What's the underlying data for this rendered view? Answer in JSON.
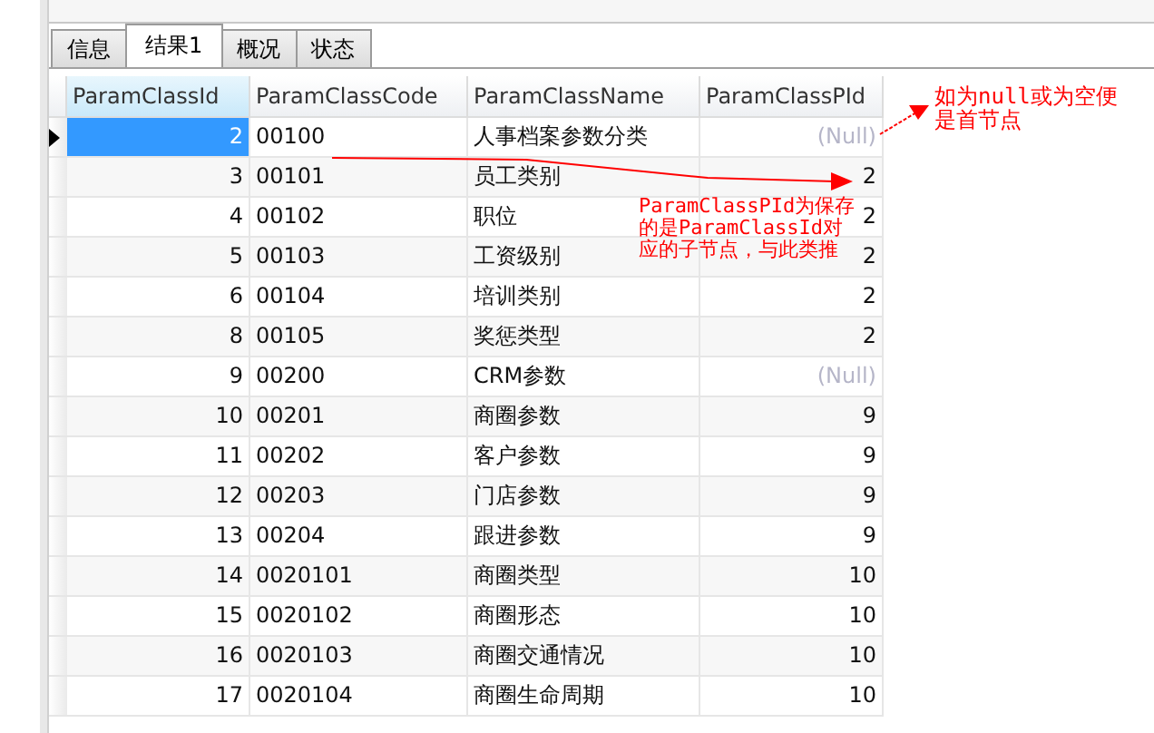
{
  "tabs": [
    {
      "label": "信息",
      "selected": false
    },
    {
      "label": "结果1",
      "selected": true
    },
    {
      "label": "概况",
      "selected": false
    },
    {
      "label": "状态",
      "selected": false
    }
  ],
  "table": {
    "columns": [
      "ParamClassId",
      "ParamClassCode",
      "ParamClassName",
      "ParamClassPId"
    ],
    "rows": [
      {
        "cells": [
          "2",
          "00100",
          "人事档案参数分类",
          "(Null)"
        ],
        "null_pid": true,
        "selected": true
      },
      {
        "cells": [
          "3",
          "00101",
          "员工类别",
          "2"
        ],
        "null_pid": false,
        "selected": false
      },
      {
        "cells": [
          "4",
          "00102",
          "职位",
          "2"
        ],
        "null_pid": false,
        "selected": false
      },
      {
        "cells": [
          "5",
          "00103",
          "工资级别",
          "2"
        ],
        "null_pid": false,
        "selected": false
      },
      {
        "cells": [
          "6",
          "00104",
          "培训类别",
          "2"
        ],
        "null_pid": false,
        "selected": false
      },
      {
        "cells": [
          "8",
          "00105",
          "奖惩类型",
          "2"
        ],
        "null_pid": false,
        "selected": false
      },
      {
        "cells": [
          "9",
          "00200",
          "CRM参数",
          "(Null)"
        ],
        "null_pid": true,
        "selected": false
      },
      {
        "cells": [
          "10",
          "00201",
          "商圈参数",
          "9"
        ],
        "null_pid": false,
        "selected": false
      },
      {
        "cells": [
          "11",
          "00202",
          "客户参数",
          "9"
        ],
        "null_pid": false,
        "selected": false
      },
      {
        "cells": [
          "12",
          "00203",
          "门店参数",
          "9"
        ],
        "null_pid": false,
        "selected": false
      },
      {
        "cells": [
          "13",
          "00204",
          "跟进参数",
          "9"
        ],
        "null_pid": false,
        "selected": false
      },
      {
        "cells": [
          "14",
          "0020101",
          "商圈类型",
          "10"
        ],
        "null_pid": false,
        "selected": false
      },
      {
        "cells": [
          "15",
          "0020102",
          "商圈形态",
          "10"
        ],
        "null_pid": false,
        "selected": false
      },
      {
        "cells": [
          "16",
          "0020103",
          "商圈交通情况",
          "10"
        ],
        "null_pid": false,
        "selected": false
      },
      {
        "cells": [
          "17",
          "0020104",
          "商圈生命周期",
          "10"
        ],
        "null_pid": false,
        "selected": false
      }
    ]
  },
  "annotations": [
    "如为null或为空便是首节点",
    "ParamClassPId为保存的是ParamClassId对应的子节点，与此类推"
  ]
}
